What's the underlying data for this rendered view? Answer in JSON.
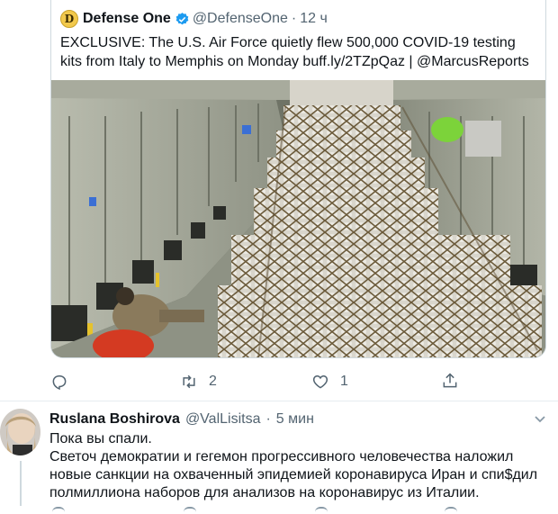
{
  "quoted_tweet": {
    "avatar_letter": "D",
    "author_name": "Defense One",
    "handle": "@DefenseOne",
    "separator": "·",
    "time": "12 ч",
    "text": "EXCLUSIVE: The U.S. Air Force quietly flew 500,000 COVID-19 testing kits from Italy to Memphis on Monday buff.ly/2TZpQaz | @MarcusReports"
  },
  "actions": {
    "reply_icon": "reply-icon",
    "retweet_icon": "retweet-icon",
    "retweet_count": "2",
    "like_icon": "heart-icon",
    "like_count": "1",
    "share_icon": "share-icon"
  },
  "reply": {
    "author_name": "Ruslana Boshirova",
    "handle": "@ValLisitsa",
    "separator": "·",
    "time": "5 мин",
    "line1": "Пока вы спали.",
    "line2": "Светоч демократии и гегемон прогрессивного человечества наложил новые санкции на охваченный эпидемией коронавируса Иран и спи$дил полмиллиона наборов для анализов на коронавирус из Италии."
  },
  "colors": {
    "verified": "#1d9bf0",
    "muted": "#536471",
    "border": "#cfd9de"
  }
}
